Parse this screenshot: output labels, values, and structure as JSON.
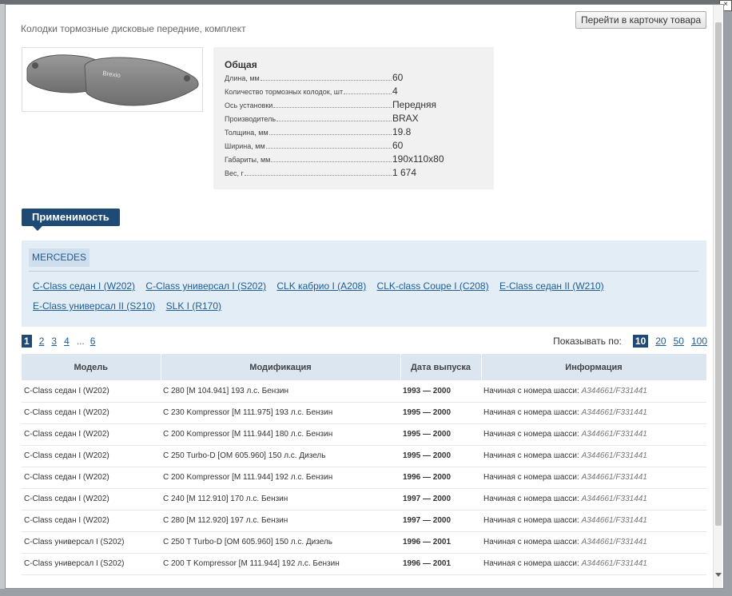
{
  "modal": {
    "title": "Колодки тормозные дисковые передние, комплект",
    "goto_button": "Перейти в карточку товара",
    "close_glyph": "×"
  },
  "product_image": {
    "brand_mark": "Brexio"
  },
  "specs": {
    "heading": "Общая",
    "rows": [
      {
        "label": "Длина, мм",
        "value": "60"
      },
      {
        "label": "Количество тормозных колодок, шт",
        "value": "4"
      },
      {
        "label": "Ось установки",
        "value": "Передняя"
      },
      {
        "label": "Производитель",
        "value": "BRAX"
      },
      {
        "label": "Толщина, мм",
        "value": "19.8"
      },
      {
        "label": "Ширина, мм",
        "value": "60"
      },
      {
        "label": "Габариты, мм",
        "value": "190x110x80"
      },
      {
        "label": "Вес, г",
        "value": "1 674"
      }
    ]
  },
  "applicability": {
    "tab_label": "Применимость",
    "brand": "MERCEDES",
    "models": [
      "C-Class седан I (W202)",
      "C-Class универсал I (S202)",
      "CLK кабрио I (A208)",
      "CLK-class Coupe I (C208)",
      "E-Class седан II (W210)",
      "E-Class универсал II (S210)",
      "SLK I (R170)"
    ]
  },
  "pagination": {
    "pages": [
      "1",
      "2",
      "3",
      "4"
    ],
    "ellipsis": "...",
    "last_page": "6",
    "current": "1"
  },
  "per_page": {
    "label": "Показывать по:",
    "options": [
      "10",
      "20",
      "50",
      "100"
    ],
    "current": "10"
  },
  "table": {
    "headers": [
      "Модель",
      "Модификация",
      "Дата выпуска",
      "Информация"
    ],
    "rows": [
      {
        "model": "C-Class седан I (W202)",
        "modification": "C 280 [M 104.941] 193 л.с. Бензин",
        "date": "1993 — 2000",
        "info": "Начиная с номера шасси:",
        "serial": "A344661/F331441"
      },
      {
        "model": "C-Class седан I (W202)",
        "modification": "C 230 Kompressor [M 111.975] 193 л.с. Бензин",
        "date": "1995 — 2000",
        "info": "Начиная с номера шасси:",
        "serial": "A344661/F331441"
      },
      {
        "model": "C-Class седан I (W202)",
        "modification": "C 200 Kompressor [M 111.944] 180 л.с. Бензин",
        "date": "1995 — 2000",
        "info": "Начиная с номера шасси:",
        "serial": "A344661/F331441"
      },
      {
        "model": "C-Class седан I (W202)",
        "modification": "C 250 Turbo-D [OM 605.960] 150 л.с. Дизель",
        "date": "1995 — 2000",
        "info": "Начиная с номера шасси:",
        "serial": "A344661/F331441"
      },
      {
        "model": "C-Class седан I (W202)",
        "modification": "C 200 Kompressor [M 111.944] 192 л.с. Бензин",
        "date": "1996 — 2000",
        "info": "Начиная с номера шасси:",
        "serial": "A344661/F331441"
      },
      {
        "model": "C-Class седан I (W202)",
        "modification": "C 240 [M 112.910] 170 л.с. Бензин",
        "date": "1997 — 2000",
        "info": "Начиная с номера шасси:",
        "serial": "A344661/F331441"
      },
      {
        "model": "C-Class седан I (W202)",
        "modification": "C 280 [M 112.920] 197 л.с. Бензин",
        "date": "1997 — 2000",
        "info": "Начиная с номера шасси:",
        "serial": "A344661/F331441"
      },
      {
        "model": "C-Class универсал I (S202)",
        "modification": "C 250 T Turbo-D [OM 605.960] 150 л.с. Дизель",
        "date": "1996 — 2001",
        "info": "Начиная с номера шасси:",
        "serial": "A344661/F331441"
      },
      {
        "model": "C-Class универсал I (S202)",
        "modification": "C 200 T Kompressor [M 111.944] 192 л.с. Бензин",
        "date": "1996 — 2001",
        "info": "Начиная с номера шасси:",
        "serial": "A344661/F331441"
      }
    ]
  },
  "colors": {
    "accent": "#1f4a75",
    "link": "#1e5c93",
    "panel_bg": "#e3edf6",
    "header_bg": "#dbe6f1"
  }
}
